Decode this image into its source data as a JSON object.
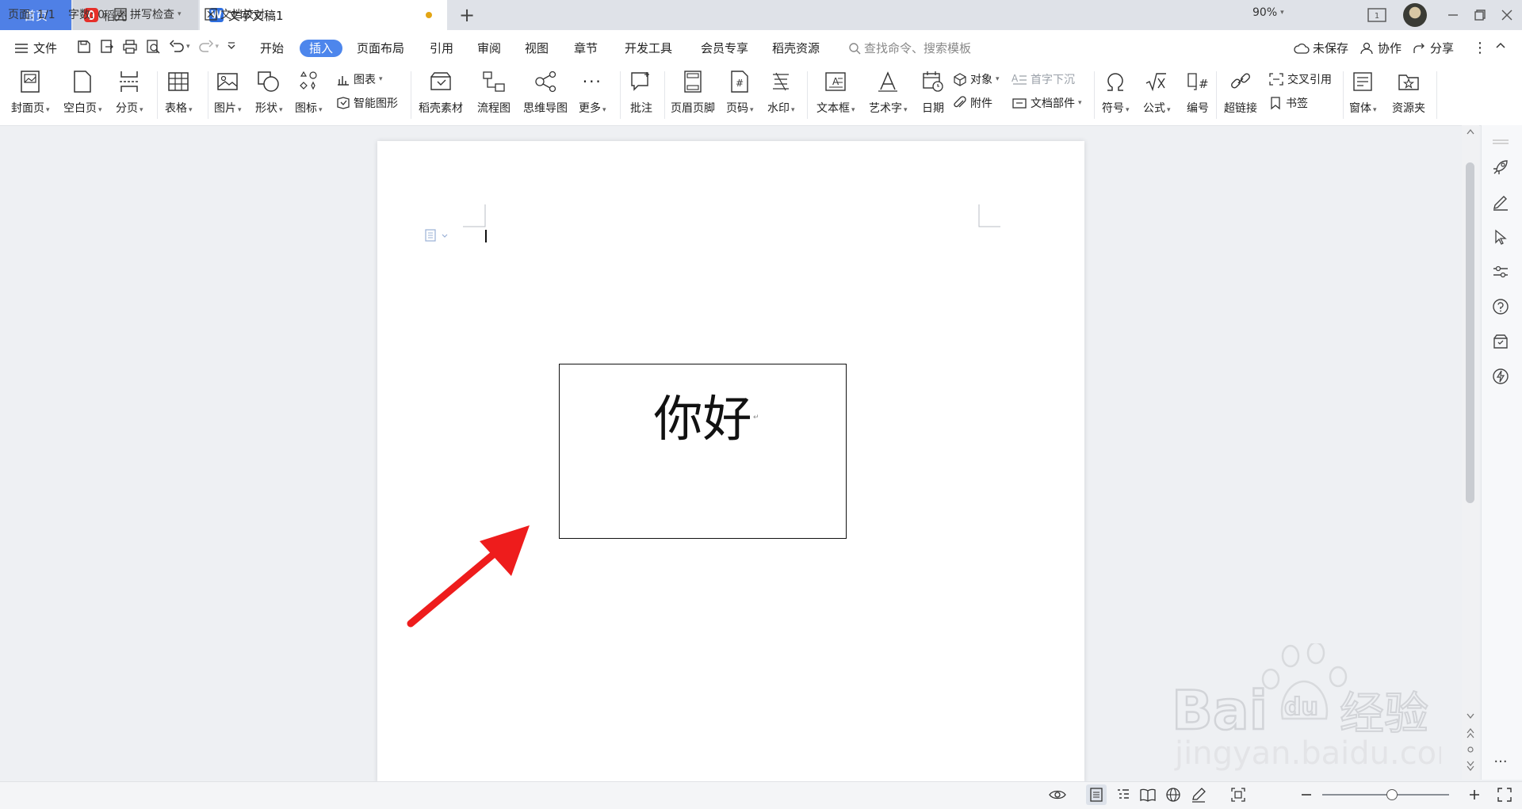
{
  "window": {
    "tabs": [
      {
        "label": "首页"
      },
      {
        "label": "稻壳"
      },
      {
        "label": "文字文稿1"
      }
    ],
    "page_badge": "1"
  },
  "menu": {
    "file": "文件",
    "items": [
      "开始",
      "插入",
      "页面布局",
      "引用",
      "审阅",
      "视图",
      "章节",
      "开发工具",
      "会员专享",
      "稻壳资源"
    ],
    "active": "插入",
    "search_placeholder": "查找命令、搜索模板",
    "unsaved": "未保存",
    "collaborate": "协作",
    "share": "分享"
  },
  "ribbon": {
    "cover": "封面页",
    "blank": "空白页",
    "break": "分页",
    "table": "表格",
    "picture": "图片",
    "shape": "形状",
    "icon": "图标",
    "chart": "图表",
    "smartart": "智能图形",
    "daoke_material": "稻壳素材",
    "flowchart": "流程图",
    "mindmap": "思维导图",
    "more": "更多",
    "comment": "批注",
    "header_footer": "页眉页脚",
    "page_number": "页码",
    "watermark": "水印",
    "textbox": "文本框",
    "wordart": "艺术字",
    "date": "日期",
    "object": "对象",
    "attachment": "附件",
    "drop_cap": "首字下沉",
    "doc_parts": "文档部件",
    "symbol": "符号",
    "formula": "公式",
    "numbering": "编号",
    "hyperlink": "超链接",
    "cross_ref": "交叉引用",
    "bookmark": "书签",
    "form": "窗体",
    "resource": "资源夹"
  },
  "document": {
    "textbox_text": "你好",
    "para_mark": "↵",
    "annotation_arrow_color": "#ee1c1c"
  },
  "status": {
    "page": "页面: 1/1",
    "words": "字数: 0",
    "spellcheck": "拼写检查",
    "proofread": "文档校对",
    "zoom": "90%",
    "zoom_level": 0.55
  },
  "watermark": {
    "brand": "Bai",
    "brand2": "du",
    "product": "经验",
    "url": "jingyan.baidu.com"
  },
  "colors": {
    "accent": "#4d86ec",
    "home_tab": "#4f80e6",
    "arrow": "#ee1c1c"
  }
}
